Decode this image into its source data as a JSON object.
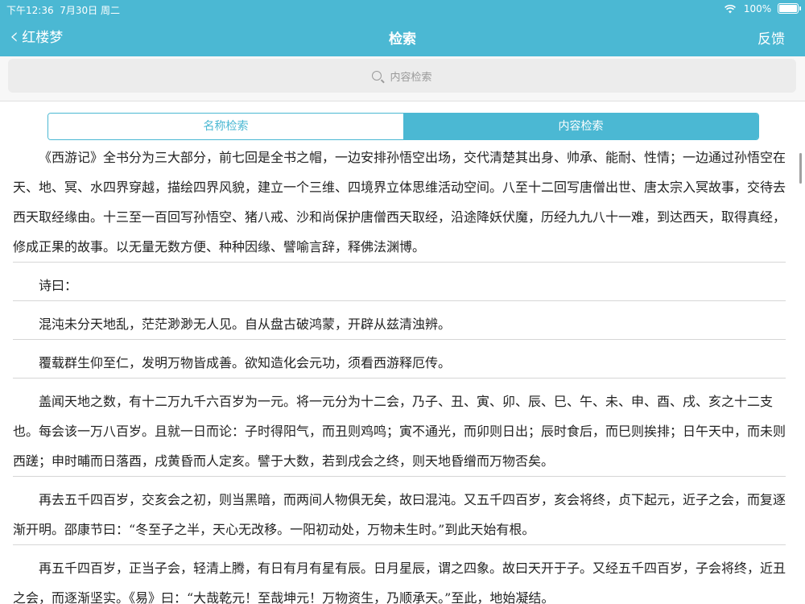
{
  "status": {
    "time": "下午12:36",
    "date": "7月30日 周二",
    "battery": "100%"
  },
  "nav": {
    "back_label": "红楼梦",
    "title": "检索",
    "feedback_label": "反馈"
  },
  "search": {
    "placeholder": "内容检索"
  },
  "tabs": [
    {
      "label": "名称检索",
      "active": false
    },
    {
      "label": "内容检索",
      "active": true
    }
  ],
  "paragraphs": [
    "《西游记》全书分为三大部分，前七回是全书之帽，一边安排孙悟空出场，交代清楚其出身、帅承、能耐、性情；一边通过孙悟空在天、地、冥、水四界穿越，描绘四界风貌，建立一个三维、四境界立体思维活动空间。八至十二回写唐僧出世、唐太宗入冥故事，交待去西天取经缘由。十三至一百回写孙悟空、猪八戒、沙和尚保护唐僧西天取经，沿途降妖伏魔，历经九九八十一难，到达西天，取得真经，修成正果的故事。以无量无数方便、种种因缘、譬喻言辞，释佛法渊博。",
    "诗曰：",
    "混沌未分天地乱，茫茫渺渺无人见。自从盘古破鸿蒙，开辟从兹清浊辨。",
    "覆载群生仰至仁，发明万物皆成善。欲知造化会元功，须看西游释厄传。",
    "盖闻天地之数，有十二万九千六百岁为一元。将一元分为十二会，乃子、丑、寅、卯、辰、巳、午、未、申、酉、戌、亥之十二支也。每会该一万八百岁。且就一日而论：子时得阳气，而丑则鸡鸣；寅不通光，而卯则日出；辰时食后，而巳则挨排；日午天中，而未则西蹉；申时晡而日落酉，戌黄昏而人定亥。譬于大数，若到戌会之终，则天地昏缯而万物否矣。",
    "再去五千四百岁，交亥会之初，则当黑暗，而两间人物俱无矣，故曰混沌。又五千四百岁，亥会将终，贞下起元，近子之会，而复逐渐开明。邵康节曰：“冬至子之半，天心无改移。一阳初动处，万物未生时。”到此天始有根。",
    "再五千四百岁，正当子会，轻清上腾，有日有月有星有辰。日月星辰，谓之四象。故曰天开于子。又经五千四百岁，子会将终，近丑之会，而逐渐坚实。《易》曰：“大哉乾元！至哉坤元！万物资生，乃顺承天。”至此，地始凝结。"
  ]
}
